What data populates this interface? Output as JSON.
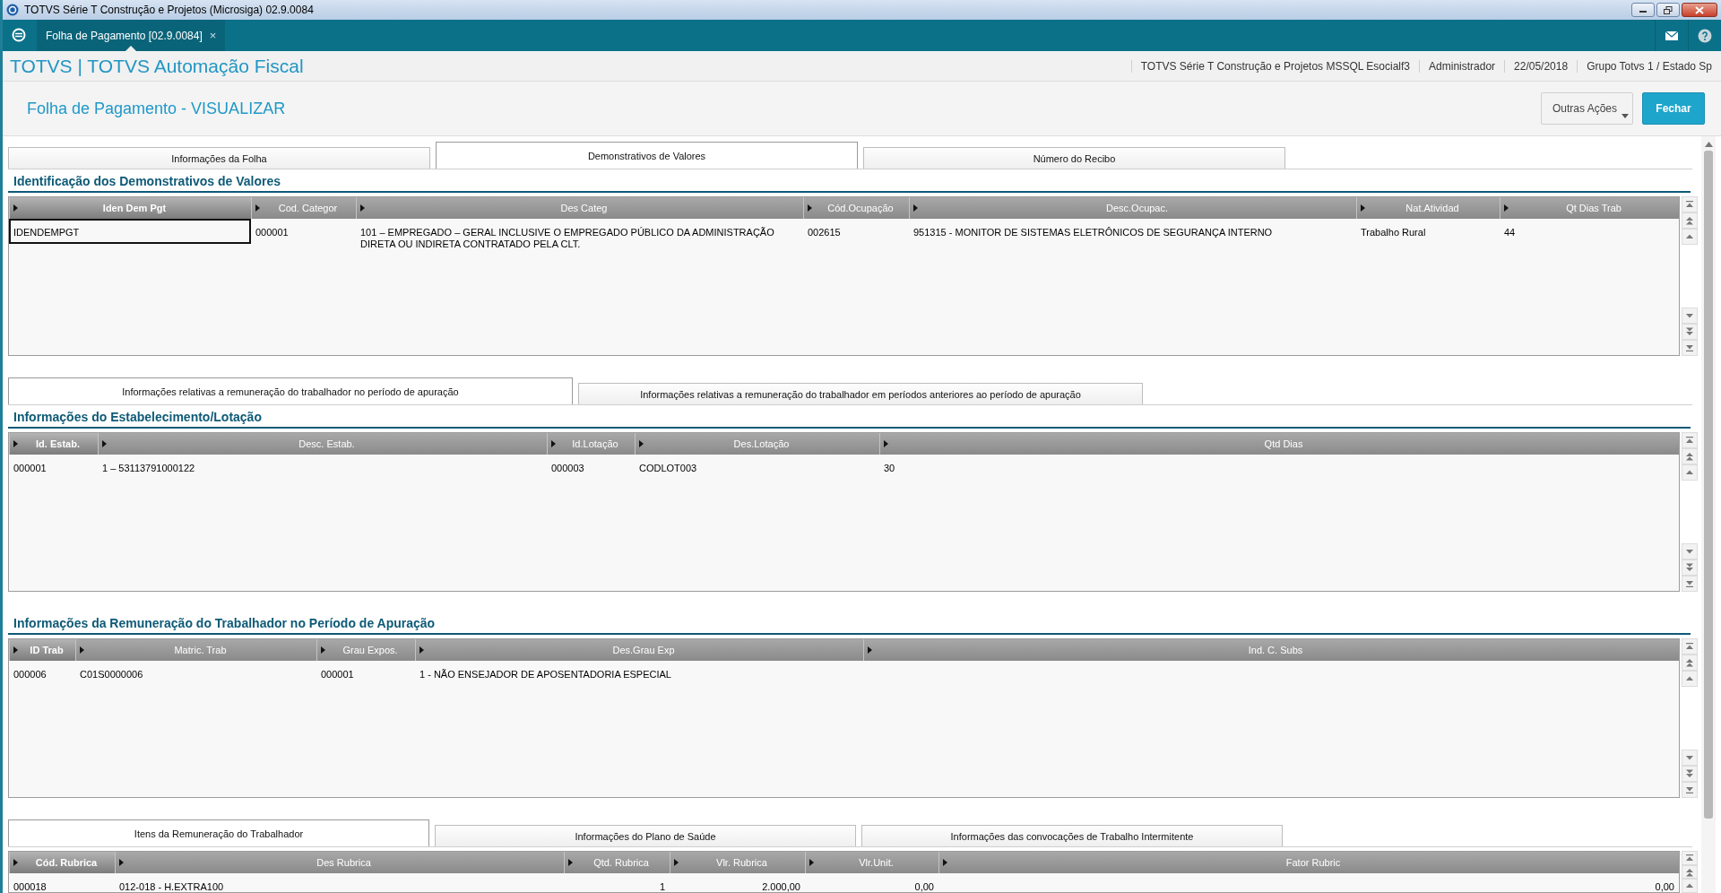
{
  "window": {
    "title": "TOTVS Série T Construção e Projetos (Microsiga) 02.9.0084"
  },
  "app_tabs": [
    {
      "label": "Folha de Pagamento [02.9.0084]",
      "close": "×",
      "selected": true
    }
  ],
  "header": {
    "brand": "TOTVS | TOTVS Automação Fiscal",
    "info": [
      "TOTVS Série T Construção e Projetos MSSQL Esocialf3",
      "Administrador",
      "22/05/2018",
      "Grupo Totvs 1 / Estado Sp"
    ]
  },
  "page": {
    "title": "Folha de Pagamento - VISUALIZAR",
    "buttons": [
      {
        "label": "Outras Ações",
        "kind": "menu"
      },
      {
        "label": "Fechar",
        "kind": "primary"
      }
    ]
  },
  "blocks": [
    {
      "kind": "tabs",
      "tabs": [
        {
          "label": "Informações da Folha",
          "selected": false
        },
        {
          "label": "Demonstrativos de Valores",
          "selected": true
        },
        {
          "label": "Número do Recibo",
          "selected": false
        }
      ]
    },
    {
      "kind": "grid",
      "title": "Identificação dos Demonstrativos de Valores",
      "columns": [
        {
          "label": "Iden Dem Pgt",
          "selected": true
        },
        {
          "label": "Cod. Categor",
          "selected": false
        },
        {
          "label": "Des Categ",
          "selected": false
        },
        {
          "label": "Cód.Ocupação",
          "selected": false
        },
        {
          "label": "Desc.Ocupac.",
          "selected": false
        },
        {
          "label": "Nat.Atividad",
          "selected": false
        },
        {
          "label": "Qt Dias Trab",
          "selected": false
        }
      ],
      "rows": [
        {
          "selected": true,
          "cells": [
            "IDENDEMPGT",
            "000001",
            "101 – EMPREGADO – GERAL INCLUSIVE O EMPREGADO PÚBLICO DA ADMINISTRAÇÃO DIRETA OU INDIRETA CONTRATADO PELA CLT.",
            "002615",
            "951315 - MONITOR DE SISTEMAS ELETRÔNICOS DE SEGURANÇA INTERNO",
            "Trabalho Rural",
            "44"
          ]
        }
      ]
    },
    {
      "kind": "tabs",
      "tabs": [
        {
          "label": "Informações relativas a remuneração do trabalhador no período de apuração",
          "selected": true
        },
        {
          "label": "Informações relativas a remuneração do trabalhador em períodos anteriores ao período de apuração",
          "selected": false
        }
      ]
    },
    {
      "kind": "grid",
      "title": "Informações do Estabelecimento/Lotação",
      "columns": [
        {
          "label": "Id. Estab.",
          "selected": true
        },
        {
          "label": "Desc. Estab.",
          "selected": false
        },
        {
          "label": "Id.Lotação",
          "selected": false
        },
        {
          "label": "Des.Lotação",
          "selected": false
        },
        {
          "label": "Qtd Dias",
          "selected": false
        }
      ],
      "rows": [
        {
          "selected": false,
          "cells": [
            "000001",
            "1 – 53113791000122",
            "000003",
            "CODLOT003",
            "30"
          ]
        }
      ]
    },
    {
      "kind": "grid",
      "title": "Informações da Remuneração do Trabalhador no Período de Apuração",
      "columns": [
        {
          "label": "ID Trab",
          "selected": true
        },
        {
          "label": "Matric. Trab",
          "selected": false
        },
        {
          "label": "Grau Expos.",
          "selected": false
        },
        {
          "label": "Des.Grau Exp",
          "selected": false
        },
        {
          "label": "Ind. C. Subs",
          "selected": false
        }
      ],
      "rows": [
        {
          "selected": false,
          "cells": [
            "000006",
            "C01S0000006",
            "000001",
            "1 - NÃO ENSEJADOR DE APOSENTADORIA ESPECIAL"
          ]
        }
      ]
    },
    {
      "kind": "tabs",
      "tabs": [
        {
          "label": "Itens da Remuneração do Trabalhador",
          "selected": true
        },
        {
          "label": "Informações do Plano de Saúde",
          "selected": false
        },
        {
          "label": "Informações das convocações de Trabalho Intermitente",
          "selected": false
        }
      ]
    },
    {
      "kind": "grid",
      "columns": [
        {
          "label": "Cód. Rubrica",
          "selected": true
        },
        {
          "label": "Des Rubrica",
          "selected": false
        },
        {
          "label": "Qtd. Rubrica",
          "selected": false
        },
        {
          "label": "Vlr. Rubrica",
          "selected": false
        },
        {
          "label": "Vlr.Unit.",
          "selected": false
        },
        {
          "label": "Fator Rubric",
          "selected": false
        }
      ],
      "rows": [
        {
          "selected": false,
          "cells": [
            "000018",
            "012-018 - H.EXTRA100",
            "1",
            "2.000,00",
            "0,00",
            "0,00"
          ]
        }
      ]
    }
  ]
}
